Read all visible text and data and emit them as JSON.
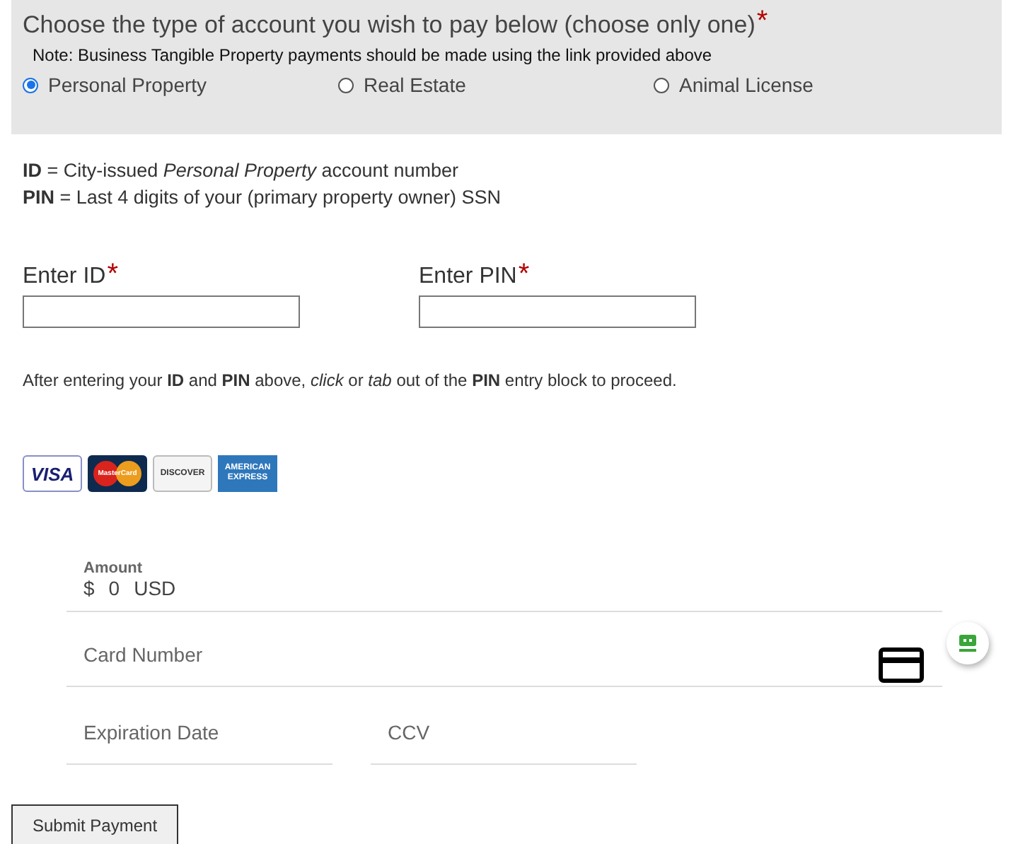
{
  "account_type": {
    "heading": "Choose the type of account you wish to pay below (choose only one)",
    "required_mark": "*",
    "note": "Note: Business Tangible Property payments should be made using the link provided above",
    "options": [
      {
        "label": "Personal Property",
        "selected": true
      },
      {
        "label": "Real Estate",
        "selected": false
      },
      {
        "label": "Animal License",
        "selected": false
      }
    ]
  },
  "definitions": [
    "**ID** = City-issued *Personal Property* account number",
    "**PIN** = Last 4 digits of your (primary property owner) SSN"
  ],
  "credentials": [
    {
      "label": "Enter ID",
      "required_mark": "*"
    },
    {
      "label": "Enter PIN",
      "required_mark": "*"
    }
  ],
  "instructions": "After entering your **ID** and **PIN** above, *click* or *tab* out of the **PIN** entry block to proceed.",
  "cards": [
    {
      "kind": "visa",
      "label": "VISA"
    },
    {
      "kind": "mastercard",
      "label": "MasterCard"
    },
    {
      "kind": "discover",
      "label": "DISCOVER"
    },
    {
      "kind": "amex",
      "label": "AMERICAN EXPRESS"
    }
  ],
  "payment": {
    "amount_label": "Amount",
    "currency_symbol": "$",
    "amount": "0",
    "currency": "USD",
    "card_number_placeholder": "Card Number",
    "expiration_placeholder": "Expiration Date",
    "ccv_placeholder": "CCV"
  },
  "submit_button": "Submit Payment"
}
